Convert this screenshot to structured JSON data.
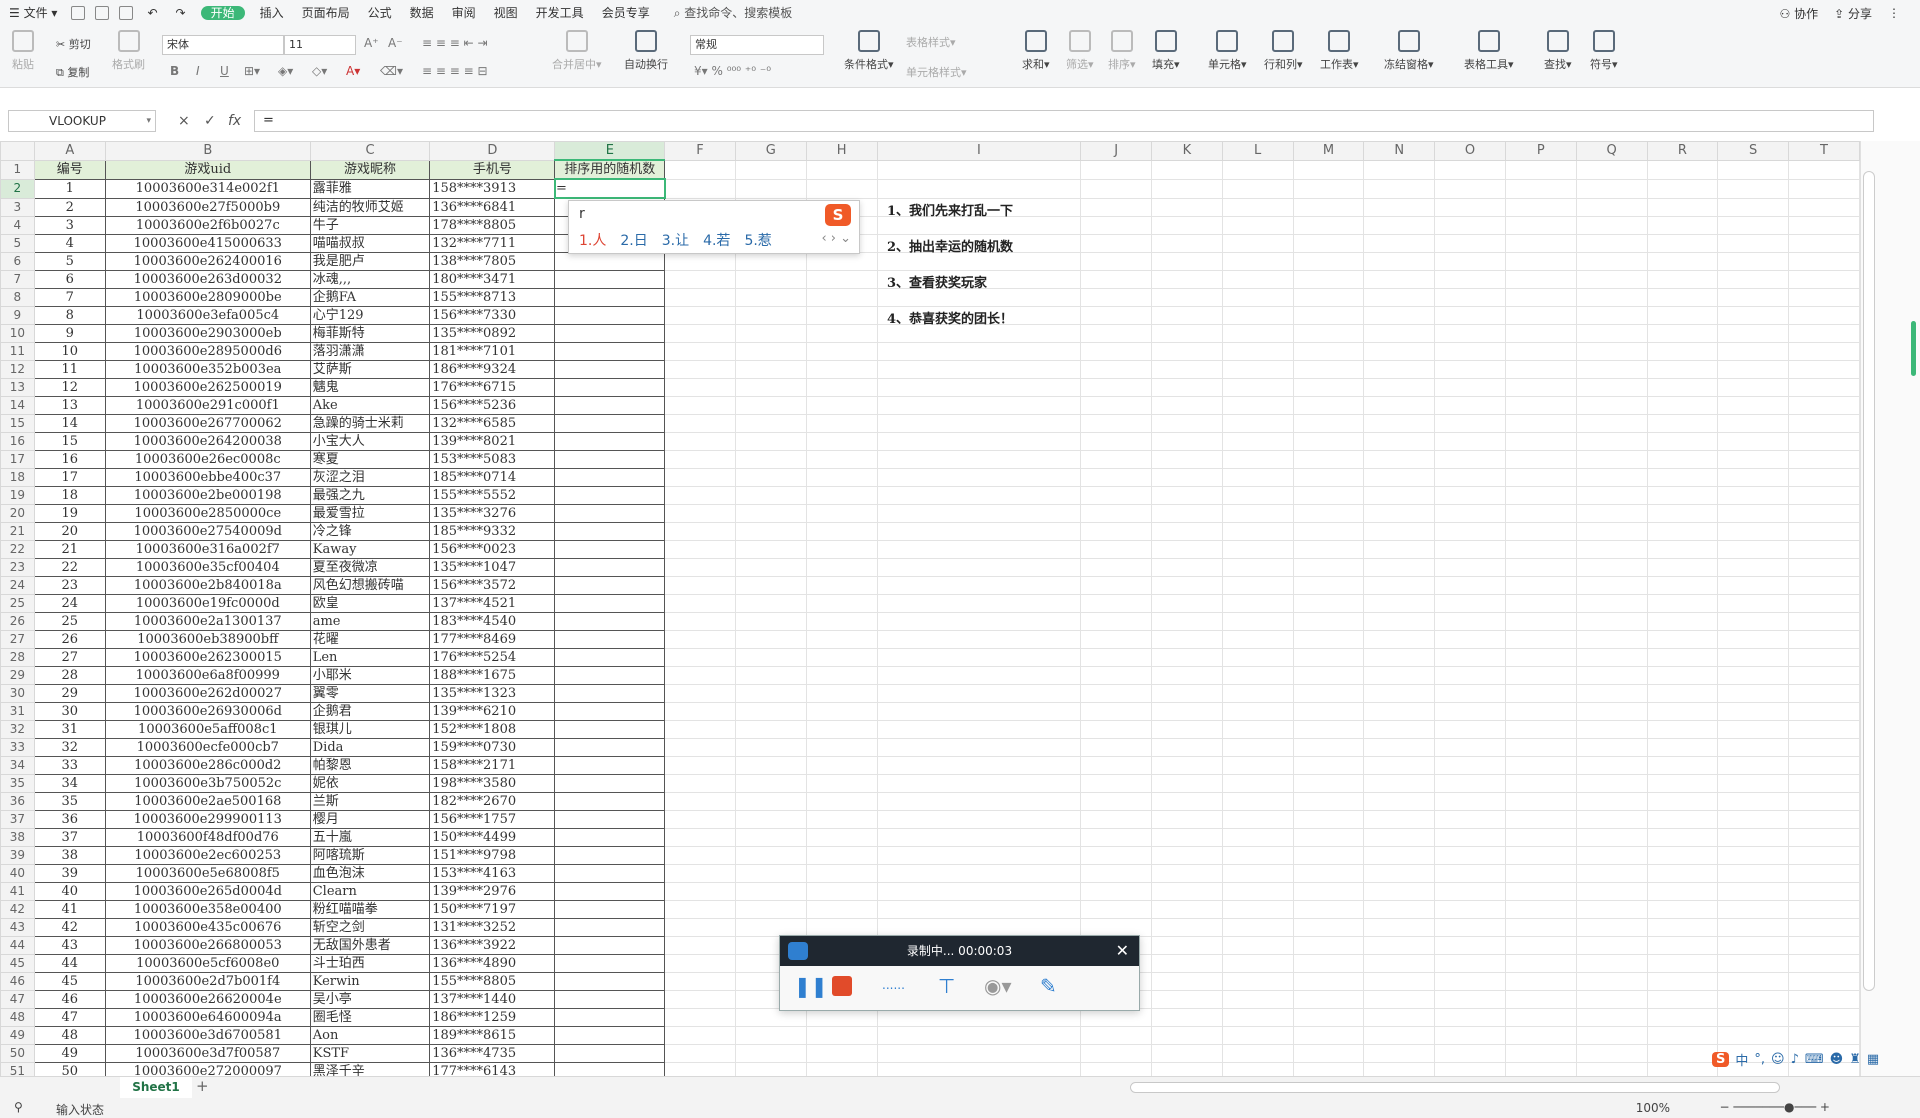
{
  "menu": {
    "file": "文件",
    "tabs": [
      "开始",
      "插入",
      "页面布局",
      "公式",
      "数据",
      "审阅",
      "视图",
      "开发工具",
      "会员专享"
    ],
    "active": "开始",
    "search": "查找命令、搜索模板",
    "right": [
      "协作",
      "分享"
    ]
  },
  "ribbon": {
    "cut": "剪切",
    "copy": "复制",
    "paste": "粘贴",
    "format_painter": "格式刷",
    "font_name": "宋体",
    "font_size": "11",
    "merge_center": "合并居中",
    "wrap": "自动换行",
    "number_format": "常规",
    "table_style": "表格样式",
    "cell_style": "单元格样式",
    "cond_format": "条件格式",
    "sum": "求和",
    "filter": "筛选",
    "sort": "排序",
    "fill": "填充",
    "cell": "单元格",
    "row_col": "行和列",
    "worksheet": "工作表",
    "freeze": "冻结窗格",
    "table_tools": "表格工具",
    "find": "查找",
    "symbol": "符号"
  },
  "formula_bar": {
    "name_box": "VLOOKUP",
    "fx": "fx",
    "cancel": "×",
    "confirm": "✓",
    "content": "="
  },
  "columns": [
    "A",
    "B",
    "C",
    "D",
    "E",
    "F",
    "G",
    "H",
    "I",
    "J",
    "K",
    "L",
    "M",
    "N",
    "O",
    "P",
    "Q",
    "R",
    "S",
    "T"
  ],
  "headers": [
    "编号",
    "游戏uid",
    "游戏昵称",
    "手机号",
    "排序用的随机数"
  ],
  "rows": [
    [
      "1",
      "10003600e314e002f1",
      "露菲雅",
      "158****3913"
    ],
    [
      "2",
      "10003600e27f5000b9",
      "纯洁的牧师艾姬",
      "136****6841"
    ],
    [
      "3",
      "10003600e2f6b0027c",
      "牛子",
      "178****8805"
    ],
    [
      "4",
      "10003600e415000633",
      "喵喵叔叔",
      "132****7711"
    ],
    [
      "5",
      "10003600e262400016",
      "我是肥卢",
      "138****7805"
    ],
    [
      "6",
      "10003600e263d00032",
      "冰魂,,,",
      "180****3471"
    ],
    [
      "7",
      "10003600e2809000be",
      "企鹅FA",
      "155****8713"
    ],
    [
      "8",
      "10003600e3efa005c4",
      "心宁129",
      "156****7330"
    ],
    [
      "9",
      "10003600e2903000eb",
      "梅菲斯特",
      "135****0892"
    ],
    [
      "10",
      "10003600e2895000d6",
      "落羽潇潇",
      "181****7101"
    ],
    [
      "11",
      "10003600e352b003ea",
      "艾萨斯",
      "186****9324"
    ],
    [
      "12",
      "10003600e262500019",
      "魑鬼",
      "176****6715"
    ],
    [
      "13",
      "10003600e291c000f1",
      "Ake",
      "156****5236"
    ],
    [
      "14",
      "10003600e267700062",
      "急躁的骑士米莉",
      "132****6585"
    ],
    [
      "15",
      "10003600e264200038",
      "小宝大人",
      "139****8021"
    ],
    [
      "16",
      "10003600e26ec0008c",
      "寒夏",
      "153****5083"
    ],
    [
      "17",
      "10003600ebbe400c37",
      "灰涩之泪",
      "185****0714"
    ],
    [
      "18",
      "10003600e2be000198",
      "最强之九",
      "155****5552"
    ],
    [
      "19",
      "10003600e2850000ce",
      "最爱雪拉",
      "135****3276"
    ],
    [
      "20",
      "10003600e27540009d",
      "冷之锋",
      "185****9332"
    ],
    [
      "21",
      "10003600e316a002f7",
      "Kaway",
      "156****0023"
    ],
    [
      "22",
      "10003600e35cf00404",
      "夏至夜微凉",
      "135****1047"
    ],
    [
      "23",
      "10003600e2b840018a",
      "风色幻想搬砖喵",
      "156****3572"
    ],
    [
      "24",
      "10003600e19fc0000d",
      "欧皇",
      "137****4521"
    ],
    [
      "25",
      "10003600e2a1300137",
      "ame",
      "183****4540"
    ],
    [
      "26",
      "10003600eb38900bff",
      "花曜",
      "177****8469"
    ],
    [
      "27",
      "10003600e262300015",
      "Len",
      "176****5254"
    ],
    [
      "28",
      "10003600e6a8f00999",
      "小耶米",
      "188****1675"
    ],
    [
      "29",
      "10003600e262d00027",
      "翼零",
      "135****1323"
    ],
    [
      "30",
      "10003600e26930006d",
      "企鹅君",
      "139****6210"
    ],
    [
      "31",
      "10003600e5aff008c1",
      "银琪儿",
      "152****1808"
    ],
    [
      "32",
      "10003600ecfe000cb7",
      "Dida",
      "159****0730"
    ],
    [
      "33",
      "10003600e286c000d2",
      "帕黎恩",
      "158****2171"
    ],
    [
      "34",
      "10003600e3b750052c",
      "妮依",
      "198****3580"
    ],
    [
      "35",
      "10003600e2ae500168",
      "兰斯",
      "182****2670"
    ],
    [
      "36",
      "10003600e299900113",
      "樱月",
      "156****1757"
    ],
    [
      "37",
      "10003600f48df00d76",
      "五十嵐",
      "150****4499"
    ],
    [
      "38",
      "10003600e2ec600253",
      "阿喀琉斯",
      "151****9798"
    ],
    [
      "39",
      "10003600e5e68008f5",
      "血色泡沫",
      "153****4163"
    ],
    [
      "40",
      "10003600e265d0004d",
      "Clearn",
      "139****2976"
    ],
    [
      "41",
      "10003600e358e00400",
      "粉红喵喵拳",
      "150****7197"
    ],
    [
      "42",
      "10003600e435c00676",
      "斩空之剑",
      "131****3252"
    ],
    [
      "43",
      "10003600e266800053",
      "无敌国外患者",
      "136****3922"
    ],
    [
      "44",
      "10003600e5cf6008e0",
      "斗士珀西",
      "136****4890"
    ],
    [
      "45",
      "10003600e2d7b001f4",
      "Kerwin",
      "155****8805"
    ],
    [
      "46",
      "10003600e26620004e",
      "吴小亭",
      "137****1440"
    ],
    [
      "47",
      "10003600e64600094a",
      "圈毛怪",
      "186****1259"
    ],
    [
      "48",
      "10003600e3d6700581",
      "Aon",
      "189****8615"
    ],
    [
      "49",
      "10003600e3d7f00587",
      "KSTF",
      "136****4735"
    ],
    [
      "50",
      "10003600e272000097",
      "黑泽千辛",
      "177****6143"
    ]
  ],
  "active_cell": {
    "ref": "E2",
    "value": "="
  },
  "ime_popup": {
    "composition": "r",
    "candidates": [
      "1.人",
      "2.日",
      "3.让",
      "4.若",
      "5.惹"
    ]
  },
  "notes": [
    "1、我们先来打乱一下",
    "2、抽出幸运的随机数",
    "3、查看获奖玩家",
    "4、恭喜获奖的团长！"
  ],
  "recorder": {
    "title": "录制中... 00:00:03",
    "dots": "......"
  },
  "sheet_tabs": [
    "Sheet1"
  ],
  "status": {
    "text": "输入状态",
    "zoom": "100%"
  },
  "ime_bar": "中"
}
